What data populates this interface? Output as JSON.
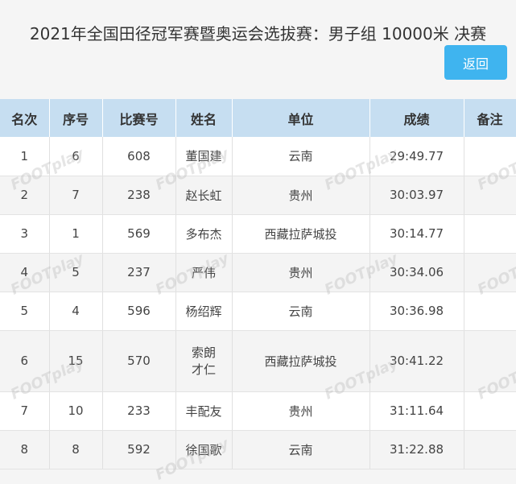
{
  "page": {
    "title": "2021年全国田径冠军赛暨奥运会选拔赛：男子组 10000米 决赛",
    "back_label": "返回"
  },
  "table": {
    "headers": [
      "名次",
      "序号",
      "比赛号",
      "姓名",
      "单位",
      "成绩",
      "备注"
    ],
    "rows": [
      {
        "rank": "1",
        "seq": "6",
        "bib": "608",
        "name": "董国建",
        "unit": "云南",
        "result": "29:49.77",
        "note": ""
      },
      {
        "rank": "2",
        "seq": "7",
        "bib": "238",
        "name": "赵长虹",
        "unit": "贵州",
        "result": "30:03.97",
        "note": ""
      },
      {
        "rank": "3",
        "seq": "1",
        "bib": "569",
        "name": "多布杰",
        "unit": "西藏拉萨城投",
        "result": "30:14.77",
        "note": ""
      },
      {
        "rank": "4",
        "seq": "5",
        "bib": "237",
        "name": "严伟",
        "unit": "贵州",
        "result": "30:34.06",
        "note": ""
      },
      {
        "rank": "5",
        "seq": "4",
        "bib": "596",
        "name": "杨绍辉",
        "unit": "云南",
        "result": "30:36.98",
        "note": ""
      },
      {
        "rank": "6",
        "seq": "15",
        "bib": "570",
        "name": "索朗才仁",
        "unit": "西藏拉萨城投",
        "result": "30:41.22",
        "note": ""
      },
      {
        "rank": "7",
        "seq": "10",
        "bib": "233",
        "name": "丰配友",
        "unit": "贵州",
        "result": "31:11.64",
        "note": ""
      },
      {
        "rank": "8",
        "seq": "8",
        "bib": "592",
        "name": "徐国歌",
        "unit": "云南",
        "result": "31:22.88",
        "note": ""
      }
    ]
  },
  "watermark": "FOOTplay"
}
